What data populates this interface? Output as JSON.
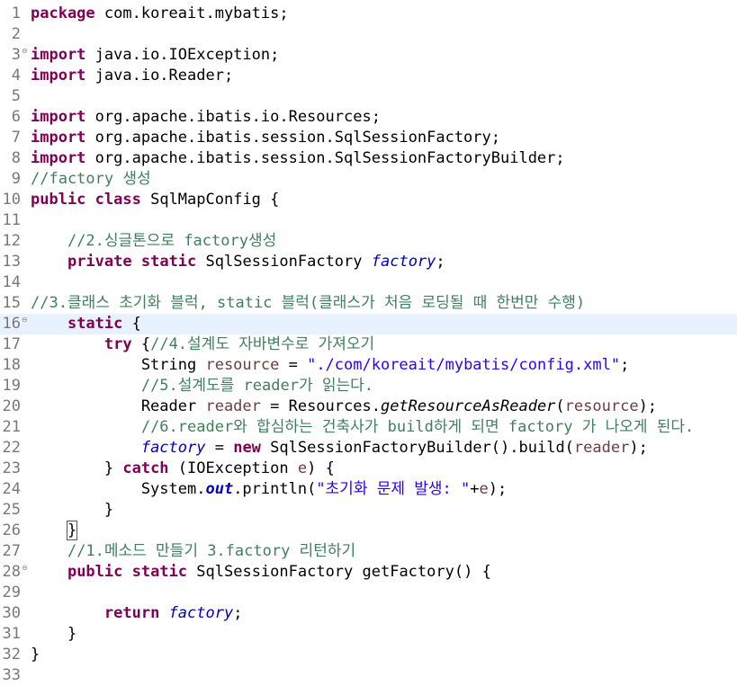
{
  "lines": [
    {
      "num": "1",
      "fold": false,
      "current": false,
      "tokens": [
        {
          "t": "kw",
          "v": "package"
        },
        {
          "t": "pl",
          "v": " com.koreait.mybatis;"
        }
      ]
    },
    {
      "num": "2",
      "fold": false,
      "current": false,
      "tokens": []
    },
    {
      "num": "3",
      "fold": true,
      "current": false,
      "tokens": [
        {
          "t": "kw",
          "v": "import"
        },
        {
          "t": "pl",
          "v": " java.io.IOException;"
        }
      ]
    },
    {
      "num": "4",
      "fold": false,
      "current": false,
      "tokens": [
        {
          "t": "kw",
          "v": "import"
        },
        {
          "t": "pl",
          "v": " java.io.Reader;"
        }
      ]
    },
    {
      "num": "5",
      "fold": false,
      "current": false,
      "tokens": []
    },
    {
      "num": "6",
      "fold": false,
      "current": false,
      "tokens": [
        {
          "t": "kw",
          "v": "import"
        },
        {
          "t": "pl",
          "v": " org.apache.ibatis.io.Resources;"
        }
      ]
    },
    {
      "num": "7",
      "fold": false,
      "current": false,
      "tokens": [
        {
          "t": "kw",
          "v": "import"
        },
        {
          "t": "pl",
          "v": " org.apache.ibatis.session.SqlSessionFactory;"
        }
      ]
    },
    {
      "num": "8",
      "fold": false,
      "current": false,
      "tokens": [
        {
          "t": "kw",
          "v": "import"
        },
        {
          "t": "pl",
          "v": " org.apache.ibatis.session.SqlSessionFactoryBuilder;"
        }
      ]
    },
    {
      "num": "9",
      "fold": false,
      "current": false,
      "tokens": [
        {
          "t": "cm",
          "v": "//factory 생성"
        }
      ]
    },
    {
      "num": "10",
      "fold": false,
      "current": false,
      "tokens": [
        {
          "t": "kw",
          "v": "public"
        },
        {
          "t": "pl",
          "v": " "
        },
        {
          "t": "kw",
          "v": "class"
        },
        {
          "t": "pl",
          "v": " SqlMapConfig {"
        }
      ]
    },
    {
      "num": "11",
      "fold": false,
      "current": false,
      "tokens": []
    },
    {
      "num": "12",
      "fold": false,
      "current": false,
      "tokens": [
        {
          "t": "pl",
          "v": "    "
        },
        {
          "t": "cm",
          "v": "//2.싱글톤으로 factory생성"
        }
      ]
    },
    {
      "num": "13",
      "fold": false,
      "current": false,
      "tokens": [
        {
          "t": "pl",
          "v": "    "
        },
        {
          "t": "kw",
          "v": "private"
        },
        {
          "t": "pl",
          "v": " "
        },
        {
          "t": "kw",
          "v": "static"
        },
        {
          "t": "pl",
          "v": " SqlSessionFactory "
        },
        {
          "t": "fd",
          "v": "factory"
        },
        {
          "t": "pl",
          "v": ";"
        }
      ]
    },
    {
      "num": "14",
      "fold": false,
      "current": false,
      "tokens": []
    },
    {
      "num": "15",
      "fold": false,
      "current": false,
      "tokens": [
        {
          "t": "cm",
          "v": "//3.클래스 초기화 블럭, static 블럭(클래스가 처음 로딩될 때 한번만 수행)"
        }
      ]
    },
    {
      "num": "16",
      "fold": true,
      "current": true,
      "tokens": [
        {
          "t": "pl",
          "v": "    "
        },
        {
          "t": "kw",
          "v": "static"
        },
        {
          "t": "pl",
          "v": " {"
        }
      ]
    },
    {
      "num": "17",
      "fold": false,
      "current": false,
      "tokens": [
        {
          "t": "pl",
          "v": "        "
        },
        {
          "t": "kw",
          "v": "try"
        },
        {
          "t": "pl",
          "v": " {"
        },
        {
          "t": "cm",
          "v": "//4.설계도 자바변수로 가져오기"
        }
      ]
    },
    {
      "num": "18",
      "fold": false,
      "current": false,
      "tokens": [
        {
          "t": "pl",
          "v": "            String "
        },
        {
          "t": "vr",
          "v": "resource"
        },
        {
          "t": "pl",
          "v": " = "
        },
        {
          "t": "st",
          "v": "\"./com/koreait/mybatis/config.xml\""
        },
        {
          "t": "pl",
          "v": ";"
        }
      ]
    },
    {
      "num": "19",
      "fold": false,
      "current": false,
      "tokens": [
        {
          "t": "pl",
          "v": "            "
        },
        {
          "t": "cm",
          "v": "//5.설계도를 reader가 읽는다."
        }
      ]
    },
    {
      "num": "20",
      "fold": false,
      "current": false,
      "tokens": [
        {
          "t": "pl",
          "v": "            Reader "
        },
        {
          "t": "vr",
          "v": "reader"
        },
        {
          "t": "pl",
          "v": " = Resources."
        },
        {
          "t": "it",
          "v": "getResourceAsReader"
        },
        {
          "t": "pl",
          "v": "("
        },
        {
          "t": "vr",
          "v": "resource"
        },
        {
          "t": "pl",
          "v": ");"
        }
      ]
    },
    {
      "num": "21",
      "fold": false,
      "current": false,
      "tokens": [
        {
          "t": "pl",
          "v": "            "
        },
        {
          "t": "cm",
          "v": "//6.reader와 합심하는 건축사가 build하게 되면 factory 가 나오게 된다."
        }
      ]
    },
    {
      "num": "22",
      "fold": false,
      "current": false,
      "tokens": [
        {
          "t": "pl",
          "v": "            "
        },
        {
          "t": "fd",
          "v": "factory"
        },
        {
          "t": "pl",
          "v": " = "
        },
        {
          "t": "kw",
          "v": "new"
        },
        {
          "t": "pl",
          "v": " SqlSessionFactoryBuilder().build("
        },
        {
          "t": "vr",
          "v": "reader"
        },
        {
          "t": "pl",
          "v": ");"
        }
      ]
    },
    {
      "num": "23",
      "fold": false,
      "current": false,
      "tokens": [
        {
          "t": "pl",
          "v": "        } "
        },
        {
          "t": "kw",
          "v": "catch"
        },
        {
          "t": "pl",
          "v": " (IOException "
        },
        {
          "t": "vr",
          "v": "e"
        },
        {
          "t": "pl",
          "v": ") {"
        }
      ]
    },
    {
      "num": "24",
      "fold": false,
      "current": false,
      "tokens": [
        {
          "t": "pl",
          "v": "            System."
        },
        {
          "t": "sf",
          "v": "out"
        },
        {
          "t": "pl",
          "v": ".println("
        },
        {
          "t": "st",
          "v": "\"초기화 문제 발생: \""
        },
        {
          "t": "pl",
          "v": "+"
        },
        {
          "t": "vr",
          "v": "e"
        },
        {
          "t": "pl",
          "v": ");"
        }
      ]
    },
    {
      "num": "25",
      "fold": false,
      "current": false,
      "tokens": [
        {
          "t": "pl",
          "v": "        }"
        }
      ]
    },
    {
      "num": "26",
      "fold": false,
      "current": false,
      "tokens": [
        {
          "t": "pl",
          "v": "    "
        },
        {
          "t": "box",
          "v": "}"
        }
      ]
    },
    {
      "num": "27",
      "fold": false,
      "current": false,
      "tokens": [
        {
          "t": "pl",
          "v": "    "
        },
        {
          "t": "cm",
          "v": "//1.메소드 만들기 3.factory 리턴하기"
        }
      ]
    },
    {
      "num": "28",
      "fold": true,
      "current": false,
      "tokens": [
        {
          "t": "pl",
          "v": "    "
        },
        {
          "t": "kw",
          "v": "public"
        },
        {
          "t": "pl",
          "v": " "
        },
        {
          "t": "kw",
          "v": "static"
        },
        {
          "t": "pl",
          "v": " SqlSessionFactory getFactory() {"
        }
      ]
    },
    {
      "num": "29",
      "fold": false,
      "current": false,
      "tokens": []
    },
    {
      "num": "30",
      "fold": false,
      "current": false,
      "tokens": [
        {
          "t": "pl",
          "v": "        "
        },
        {
          "t": "kw",
          "v": "return"
        },
        {
          "t": "pl",
          "v": " "
        },
        {
          "t": "fd",
          "v": "factory"
        },
        {
          "t": "pl",
          "v": ";"
        }
      ]
    },
    {
      "num": "31",
      "fold": false,
      "current": false,
      "tokens": [
        {
          "t": "pl",
          "v": "    }"
        }
      ]
    },
    {
      "num": "32",
      "fold": false,
      "current": false,
      "tokens": [
        {
          "t": "pl",
          "v": "}"
        }
      ]
    },
    {
      "num": "33",
      "fold": false,
      "current": false,
      "tokens": []
    }
  ],
  "colors": {
    "keyword": "#7f0055",
    "comment": "#3f7f5f",
    "string": "#2a00ff",
    "field": "#0000c0",
    "local_variable": "#6a3e3e",
    "line_number": "#787878",
    "current_line": "#e8f2fe"
  },
  "icons": {
    "fold": "fold-collapse-icon"
  }
}
